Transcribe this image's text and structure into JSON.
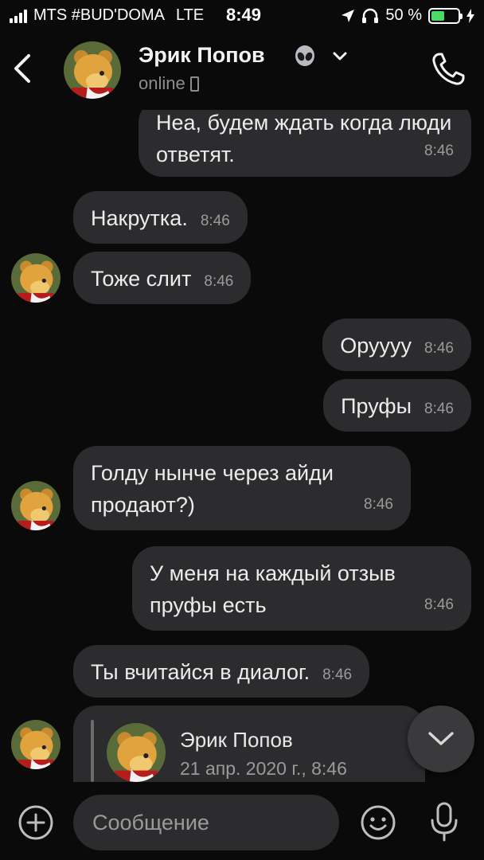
{
  "status_bar": {
    "carrier": "MTS #BUD'DOMA",
    "network": "LTE",
    "time": "8:49",
    "battery": "50 %",
    "battery_level": 0.5
  },
  "header": {
    "name": "Эрик Попов",
    "status": "online",
    "icons": [
      "back-icon",
      "alien-emoji-icon",
      "chevron-down-icon",
      "phone-icon"
    ]
  },
  "messages": [
    {
      "direction": "out",
      "text": "Неа, будем ждать когда люди ответят.",
      "time": "8:46"
    },
    {
      "direction": "in",
      "text": "Накрутка.",
      "time": "8:46"
    },
    {
      "direction": "in",
      "text": "Тоже слит",
      "time": "8:46"
    },
    {
      "direction": "out",
      "text": "Оруууу",
      "time": "8:46"
    },
    {
      "direction": "out",
      "text": "Пруфы",
      "time": "8:46"
    },
    {
      "direction": "in",
      "text": "Голду нынче через айди продают?)",
      "time": "8:46"
    },
    {
      "direction": "out",
      "text": "У меня на каждый отзыв пруфы есть",
      "time": "8:46"
    },
    {
      "direction": "in",
      "text": "Ты вчитайся в диалог.",
      "time": "8:46"
    }
  ],
  "forwarded": {
    "name": "Эрик Попов",
    "date": "21 апр. 2020 г., 8:46"
  },
  "composer": {
    "placeholder": "Сообщение"
  },
  "colors": {
    "background": "#0a0a0a",
    "bubble": "#2c2c2e",
    "secondary_text": "#9a9a9a",
    "battery": "#4cd964"
  }
}
